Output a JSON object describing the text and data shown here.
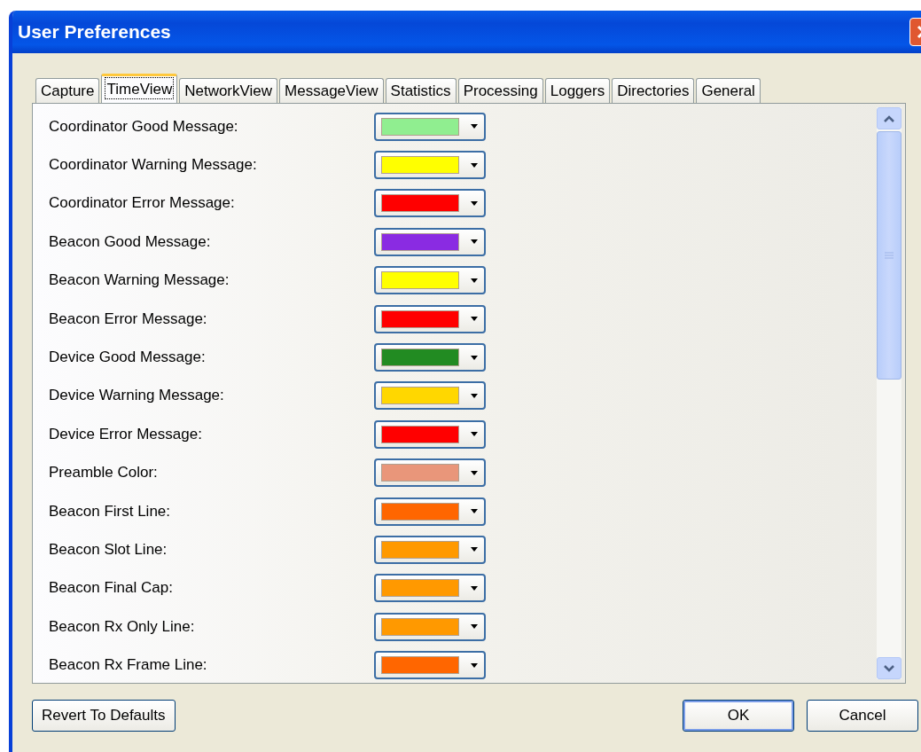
{
  "window": {
    "title": "User Preferences"
  },
  "tabs": [
    {
      "label": "Capture",
      "selected": false
    },
    {
      "label": "TimeView",
      "selected": true
    },
    {
      "label": "NetworkView",
      "selected": false
    },
    {
      "label": "MessageView",
      "selected": false
    },
    {
      "label": "Statistics",
      "selected": false
    },
    {
      "label": "Processing",
      "selected": false
    },
    {
      "label": "Loggers",
      "selected": false
    },
    {
      "label": "Directories",
      "selected": false
    },
    {
      "label": "General",
      "selected": false
    }
  ],
  "settings": [
    {
      "label": "Coordinator Good Message:",
      "color": "#90ee90"
    },
    {
      "label": "Coordinator Warning Message:",
      "color": "#ffff00"
    },
    {
      "label": "Coordinator Error Message:",
      "color": "#ff0000"
    },
    {
      "label": "Beacon Good Message:",
      "color": "#8a2be2"
    },
    {
      "label": "Beacon Warning Message:",
      "color": "#ffff00"
    },
    {
      "label": "Beacon Error Message:",
      "color": "#ff0000"
    },
    {
      "label": "Device Good Message:",
      "color": "#228b22"
    },
    {
      "label": "Device Warning Message:",
      "color": "#ffd700"
    },
    {
      "label": "Device Error Message:",
      "color": "#ff0000"
    },
    {
      "label": "Preamble Color:",
      "color": "#e9967a"
    },
    {
      "label": "Beacon First Line:",
      "color": "#ff6600"
    },
    {
      "label": "Beacon Slot Line:",
      "color": "#ff9900"
    },
    {
      "label": "Beacon Final Cap:",
      "color": "#ff9900"
    },
    {
      "label": "Beacon Rx Only Line:",
      "color": "#ff9900"
    },
    {
      "label": "Beacon Rx Frame Line:",
      "color": "#ff6600"
    }
  ],
  "buttons": {
    "revert": "Revert To Defaults",
    "ok": "OK",
    "cancel": "Cancel"
  }
}
